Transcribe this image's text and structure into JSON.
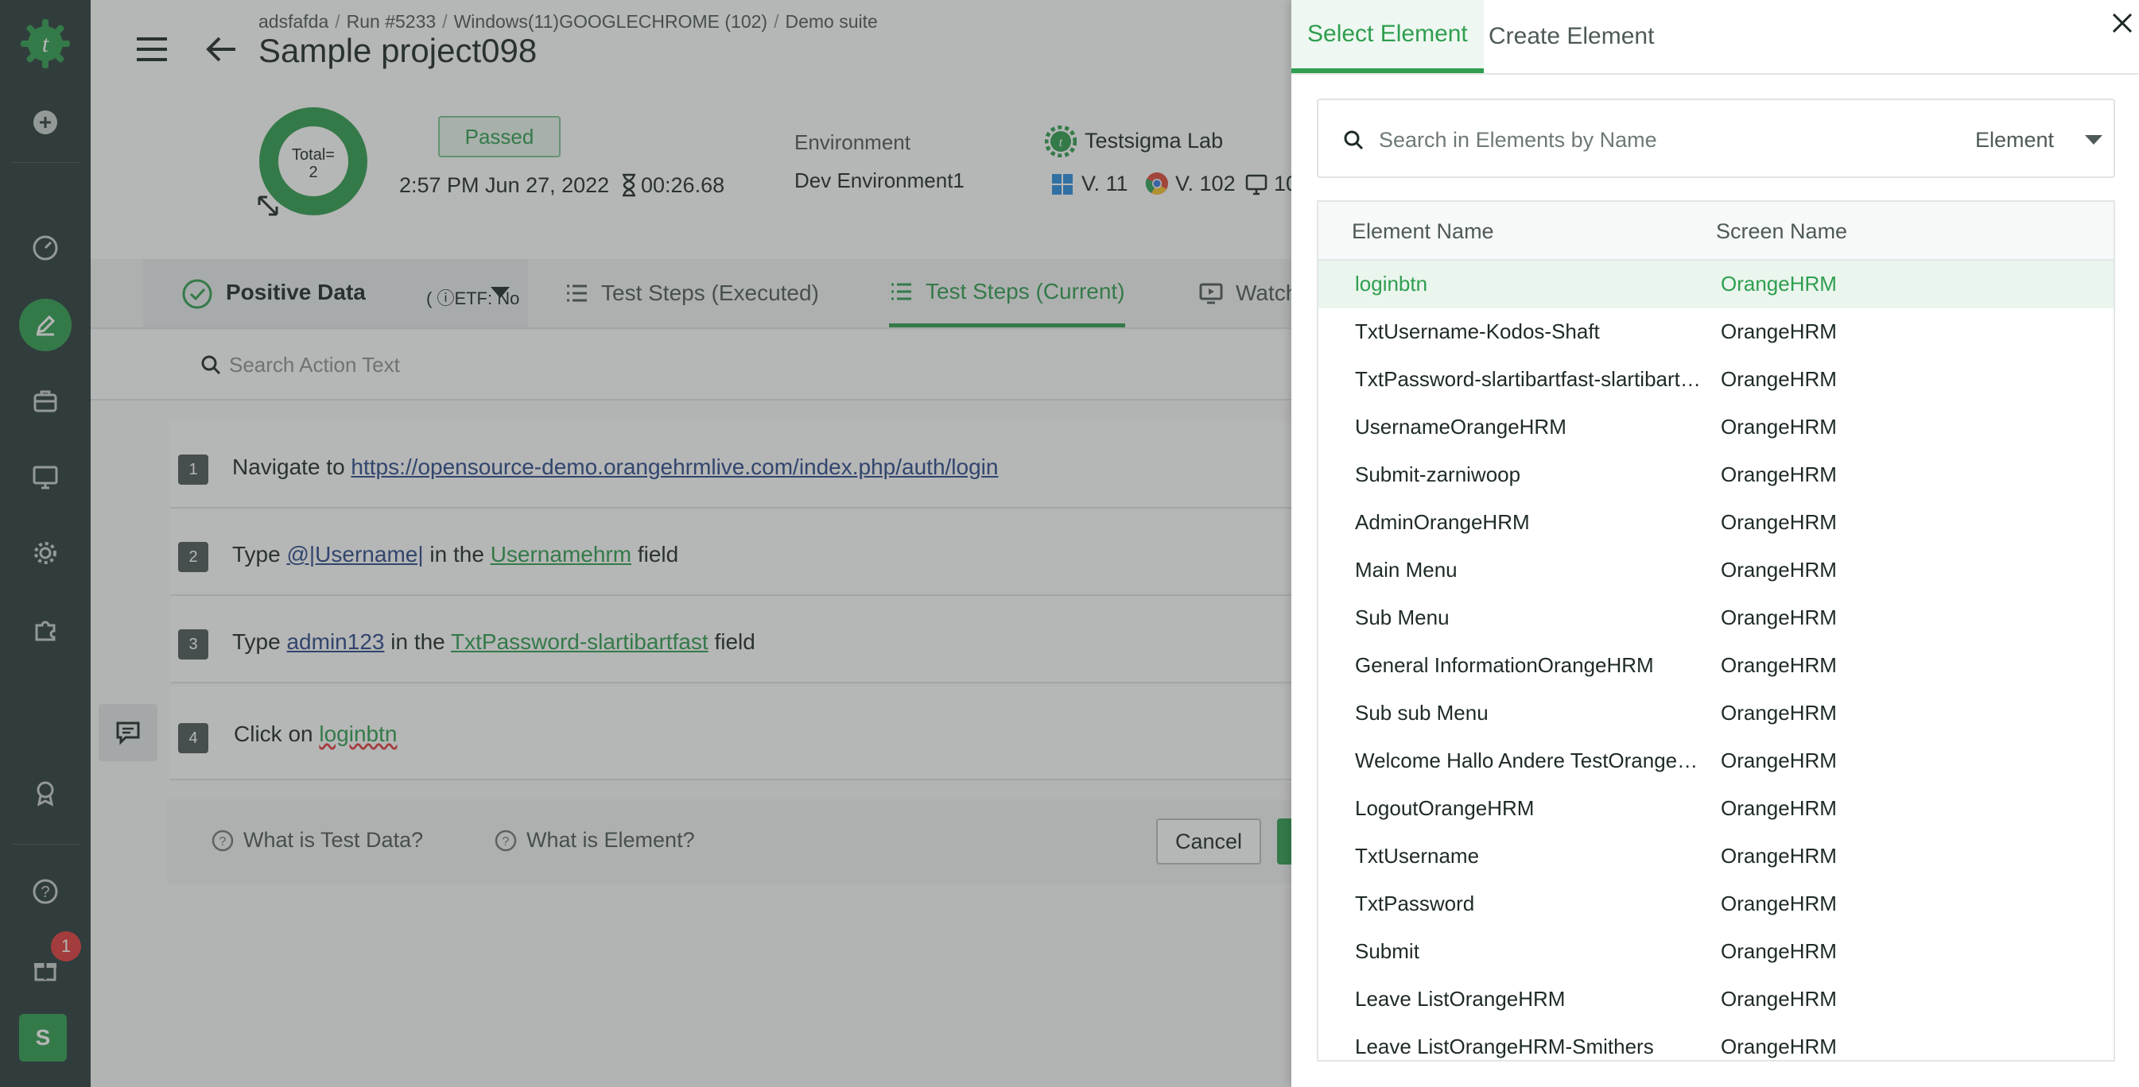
{
  "breadcrumb": [
    "adsfafda",
    "Run #5233",
    "Windows(11)GOOGLECHROME (102)",
    "Demo suite"
  ],
  "title": "Sample project098",
  "summary": {
    "total_line1": "Total=",
    "total_line2": "2",
    "status": "Passed",
    "run_time": "2:57 PM Jun 27, 2022",
    "duration": "00:26.68",
    "environment_label": "Environment",
    "environment_value": "Dev Environment1",
    "lab": "Testsigma Lab",
    "os_version": "V. 11",
    "browser_version": "V. 102",
    "resolution": "10"
  },
  "tabs": {
    "data_set": "Positive Data",
    "etf": "( ⓘETF: No",
    "executed": "Test Steps (Executed)",
    "current": "Test Steps (Current)",
    "watch": "Watch"
  },
  "step_search_placeholder": "Search Action Text",
  "steps": [
    {
      "num": "1",
      "pre": "Navigate to ",
      "link": "https://opensource-demo.orangehrmlive.com/index.php/auth/login"
    },
    {
      "num": "2",
      "pre": "Type ",
      "data": "@|Username|",
      "mid": " in the ",
      "element": "Usernamehrm",
      "post": " field"
    },
    {
      "num": "3",
      "pre": "Type ",
      "data": "admin123",
      "mid": " in the ",
      "element": "TxtPassword-slartibartfast",
      "post": " field"
    },
    {
      "num": "4",
      "pre": "Click on ",
      "element": "loginbtn"
    }
  ],
  "footer": {
    "help_test_data": "What is Test Data?",
    "help_element": "What is Element?",
    "cancel": "Cancel"
  },
  "rail": {
    "badge": "1",
    "avatar": "S"
  },
  "panel": {
    "tab_select": "Select Element",
    "tab_create": "Create Element",
    "search_placeholder": "Search in Elements by Name",
    "filter": "Element",
    "col_element": "Element Name",
    "col_screen": "Screen Name",
    "rows": [
      {
        "name": "loginbtn",
        "screen": "OrangeHRM"
      },
      {
        "name": "TxtUsername-Kodos-Shaft",
        "screen": "OrangeHRM"
      },
      {
        "name": "TxtPassword-slartibartfast-slartibartfast",
        "screen": "OrangeHRM"
      },
      {
        "name": "UsernameOrangeHRM",
        "screen": "OrangeHRM"
      },
      {
        "name": "Submit-zarniwoop",
        "screen": "OrangeHRM"
      },
      {
        "name": "AdminOrangeHRM",
        "screen": "OrangeHRM"
      },
      {
        "name": "Main Menu",
        "screen": "OrangeHRM"
      },
      {
        "name": "Sub Menu",
        "screen": "OrangeHRM"
      },
      {
        "name": "General InformationOrangeHRM",
        "screen": "OrangeHRM"
      },
      {
        "name": "Sub sub Menu",
        "screen": "OrangeHRM"
      },
      {
        "name": "Welcome Hallo Andere TestOrangeHRM",
        "screen": "OrangeHRM"
      },
      {
        "name": "LogoutOrangeHRM",
        "screen": "OrangeHRM"
      },
      {
        "name": "TxtUsername",
        "screen": "OrangeHRM"
      },
      {
        "name": "TxtPassword",
        "screen": "OrangeHRM"
      },
      {
        "name": "Submit",
        "screen": "OrangeHRM"
      },
      {
        "name": "Leave ListOrangeHRM",
        "screen": "OrangeHRM"
      },
      {
        "name": "Leave ListOrangeHRM-Smithers",
        "screen": "OrangeHRM"
      }
    ]
  }
}
